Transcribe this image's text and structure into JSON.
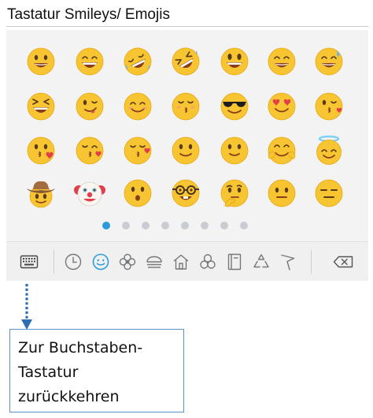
{
  "page": {
    "heading": "Tastatur Smileys/ Emojis"
  },
  "emoji_panel": {
    "rows": [
      [
        "grinning-face",
        "beaming-face",
        "rolling-on-floor-laughing",
        "laughing-face",
        "grinning-face-big-eyes",
        "grinning-squinting-face",
        "grinning-face-sweat"
      ],
      [
        "squinting-face-tongue",
        "winking-face",
        "smiling-face",
        "kissing-closed-eyes",
        "smiling-face-sunglasses",
        "smiling-face-heart-eyes",
        "kissing-face"
      ],
      [
        "kissing-face-heart",
        "face-blowing-kiss",
        "kissing-face-closed-eyes",
        "slightly-smiling-face",
        "smiling-face-plain",
        "hugging-face",
        "smiling-face-halo"
      ],
      [
        "cowboy-face",
        "clown-face",
        "hushed-face",
        "nerd-face",
        "thinking-face",
        "neutral-face",
        "expressionless-face"
      ]
    ],
    "page_count": 8,
    "active_page": 1,
    "accent_color": "#2d9bd7"
  },
  "toolbar": {
    "icons": [
      "keyboard-icon",
      "recent-icon",
      "smiley-category-icon",
      "animals-nature-icon",
      "food-drink-icon",
      "buildings-icon",
      "activities-icon",
      "objects-icon",
      "symbols-icon",
      "flags-icon",
      "backspace-icon"
    ],
    "active_icon": "smiley-category-icon"
  },
  "callout": {
    "line1": "Zur Buchstaben-",
    "line2": "Tastatur",
    "line3": "zurückkehren",
    "border_color": "#5b8fc9",
    "arrow_color": "#2e6db4"
  }
}
